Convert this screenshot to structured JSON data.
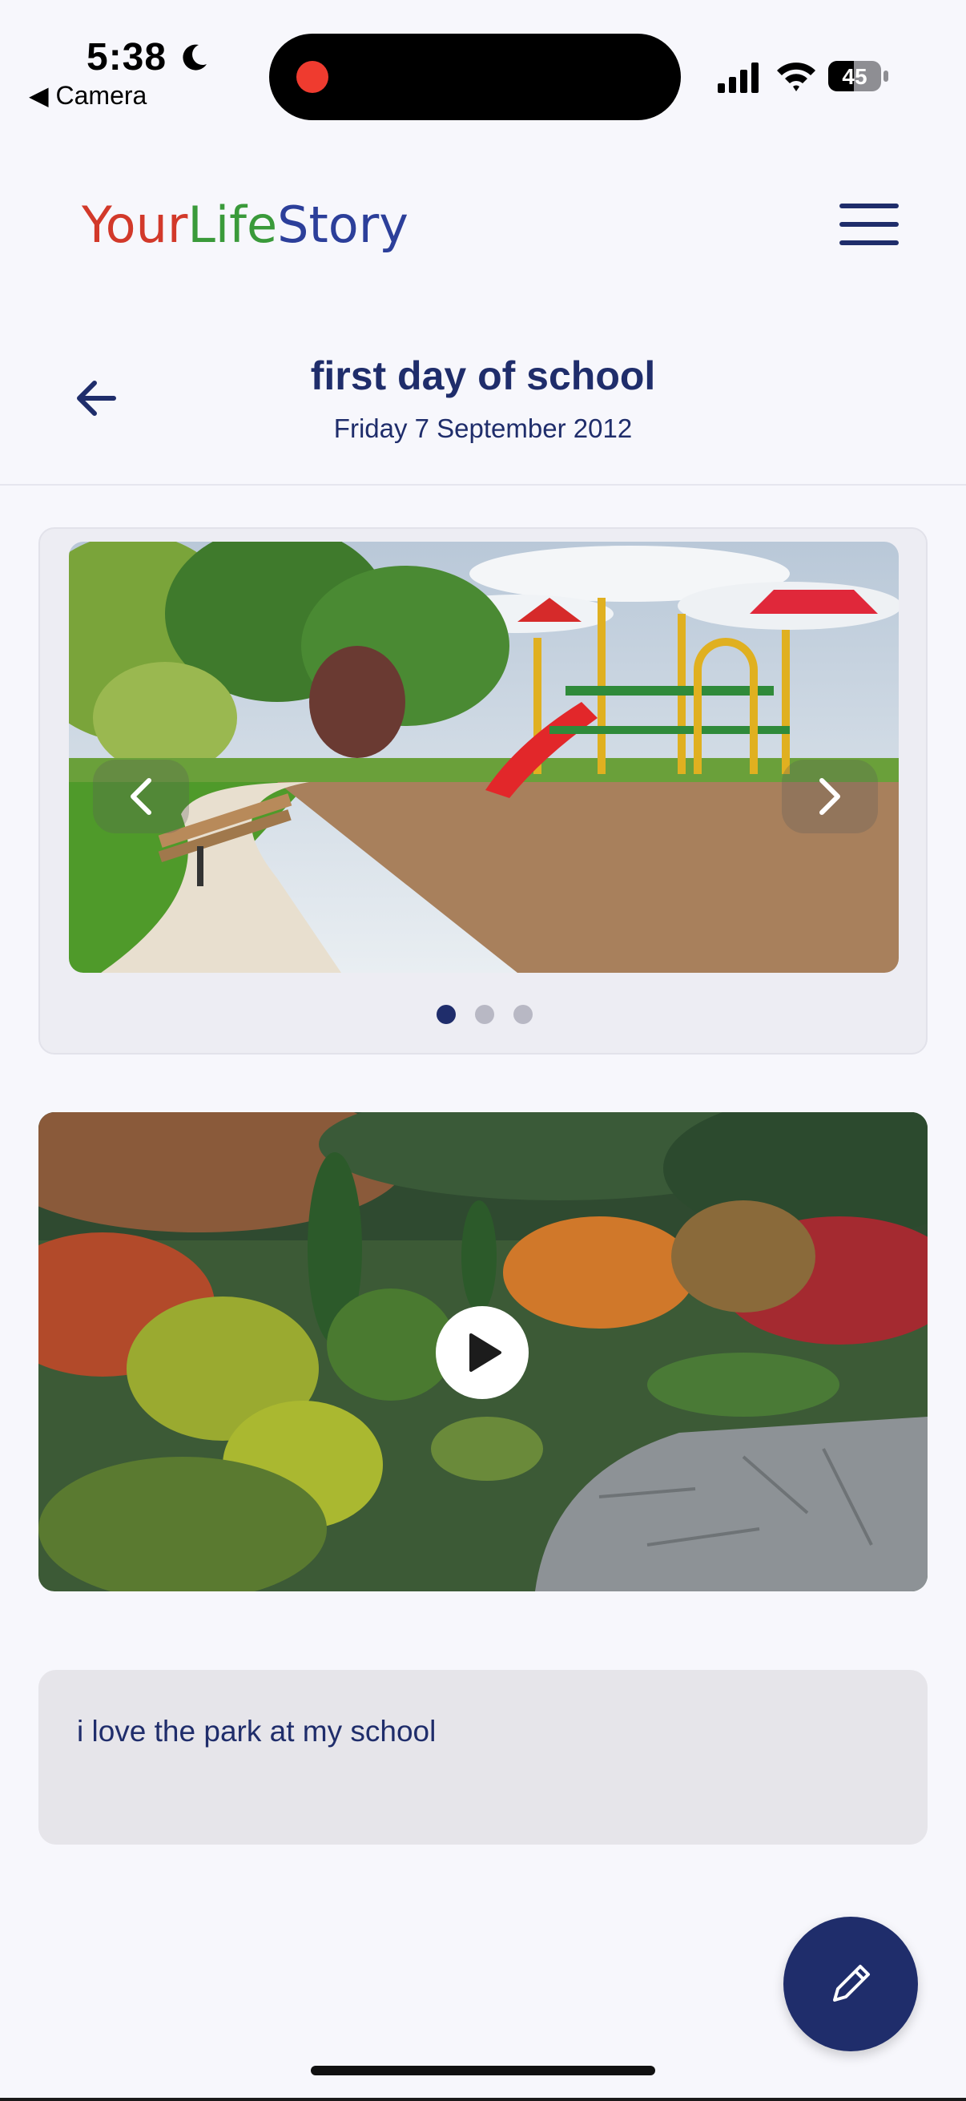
{
  "status_bar": {
    "time": "5:38",
    "back_app": "◀ Camera",
    "battery": "45"
  },
  "header": {
    "logo_part1": "Your",
    "logo_part2": "Life",
    "logo_part3": "Story"
  },
  "entry": {
    "title": "first day of school",
    "date": "Friday 7 September 2012"
  },
  "carousel": {
    "total_slides": 3,
    "active_slide": 1
  },
  "caption": {
    "text": "i love the park at my school"
  },
  "colors": {
    "primary": "#1f2d6b",
    "background": "#f7f7fc",
    "logo_red": "#d2392a",
    "logo_green": "#3a9a3a",
    "logo_blue": "#2c3f9a"
  },
  "icons": {
    "menu": "hamburger-menu-icon",
    "back": "arrow-left-icon",
    "prev": "chevron-left-icon",
    "next": "chevron-right-icon",
    "play": "play-icon",
    "edit": "pencil-icon"
  }
}
